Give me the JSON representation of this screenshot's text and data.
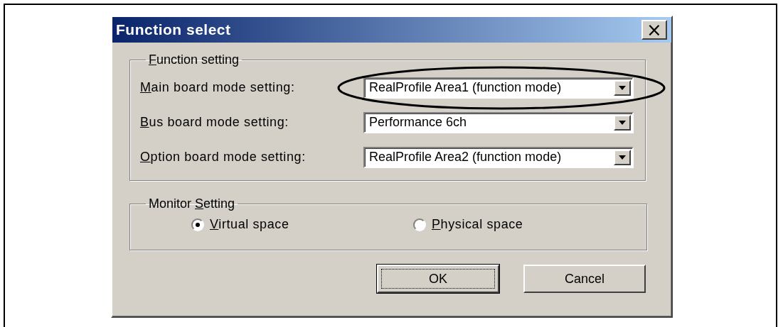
{
  "window": {
    "title": "Function select",
    "close_symbol": "×"
  },
  "function_setting": {
    "legend": {
      "key": "F",
      "post": "unction setting"
    },
    "rows": [
      {
        "label": {
          "key": "M",
          "post": "ain board mode setting:"
        },
        "value": "RealProfile Area1 (function mode)",
        "highlighted": true
      },
      {
        "label": {
          "key": "B",
          "post": "us board mode setting:"
        },
        "value": "Performance 6ch",
        "highlighted": false
      },
      {
        "label": {
          "key": "O",
          "post": "ption board mode setting:"
        },
        "value": "RealProfile Area2 (function mode)",
        "highlighted": false
      }
    ]
  },
  "monitor_setting": {
    "legend": {
      "pre": "Monitor ",
      "key": "S",
      "post": "etting"
    },
    "options": [
      {
        "label": {
          "key": "V",
          "post": "irtual space"
        },
        "selected": true
      },
      {
        "label": {
          "key": "P",
          "post": "hysical space"
        },
        "selected": false
      }
    ]
  },
  "buttons": [
    {
      "label": "OK",
      "default": true
    },
    {
      "label": "Cancel",
      "default": false
    }
  ]
}
